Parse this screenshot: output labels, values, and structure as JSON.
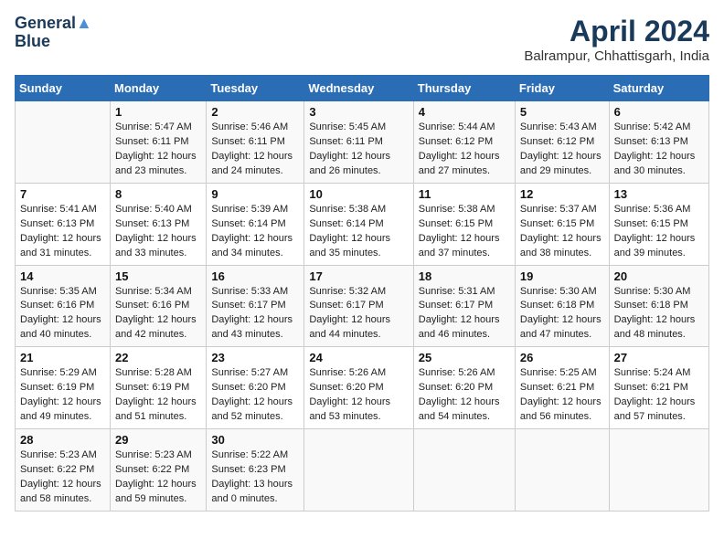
{
  "header": {
    "logo_line1": "General",
    "logo_line2": "Blue",
    "month": "April 2024",
    "location": "Balrampur, Chhattisgarh, India"
  },
  "columns": [
    "Sunday",
    "Monday",
    "Tuesday",
    "Wednesday",
    "Thursday",
    "Friday",
    "Saturday"
  ],
  "weeks": [
    [
      {
        "date": "",
        "sunrise": "",
        "sunset": "",
        "daylight": ""
      },
      {
        "date": "1",
        "sunrise": "Sunrise: 5:47 AM",
        "sunset": "Sunset: 6:11 PM",
        "daylight": "Daylight: 12 hours and 23 minutes."
      },
      {
        "date": "2",
        "sunrise": "Sunrise: 5:46 AM",
        "sunset": "Sunset: 6:11 PM",
        "daylight": "Daylight: 12 hours and 24 minutes."
      },
      {
        "date": "3",
        "sunrise": "Sunrise: 5:45 AM",
        "sunset": "Sunset: 6:11 PM",
        "daylight": "Daylight: 12 hours and 26 minutes."
      },
      {
        "date": "4",
        "sunrise": "Sunrise: 5:44 AM",
        "sunset": "Sunset: 6:12 PM",
        "daylight": "Daylight: 12 hours and 27 minutes."
      },
      {
        "date": "5",
        "sunrise": "Sunrise: 5:43 AM",
        "sunset": "Sunset: 6:12 PM",
        "daylight": "Daylight: 12 hours and 29 minutes."
      },
      {
        "date": "6",
        "sunrise": "Sunrise: 5:42 AM",
        "sunset": "Sunset: 6:13 PM",
        "daylight": "Daylight: 12 hours and 30 minutes."
      }
    ],
    [
      {
        "date": "7",
        "sunrise": "Sunrise: 5:41 AM",
        "sunset": "Sunset: 6:13 PM",
        "daylight": "Daylight: 12 hours and 31 minutes."
      },
      {
        "date": "8",
        "sunrise": "Sunrise: 5:40 AM",
        "sunset": "Sunset: 6:13 PM",
        "daylight": "Daylight: 12 hours and 33 minutes."
      },
      {
        "date": "9",
        "sunrise": "Sunrise: 5:39 AM",
        "sunset": "Sunset: 6:14 PM",
        "daylight": "Daylight: 12 hours and 34 minutes."
      },
      {
        "date": "10",
        "sunrise": "Sunrise: 5:38 AM",
        "sunset": "Sunset: 6:14 PM",
        "daylight": "Daylight: 12 hours and 35 minutes."
      },
      {
        "date": "11",
        "sunrise": "Sunrise: 5:38 AM",
        "sunset": "Sunset: 6:15 PM",
        "daylight": "Daylight: 12 hours and 37 minutes."
      },
      {
        "date": "12",
        "sunrise": "Sunrise: 5:37 AM",
        "sunset": "Sunset: 6:15 PM",
        "daylight": "Daylight: 12 hours and 38 minutes."
      },
      {
        "date": "13",
        "sunrise": "Sunrise: 5:36 AM",
        "sunset": "Sunset: 6:15 PM",
        "daylight": "Daylight: 12 hours and 39 minutes."
      }
    ],
    [
      {
        "date": "14",
        "sunrise": "Sunrise: 5:35 AM",
        "sunset": "Sunset: 6:16 PM",
        "daylight": "Daylight: 12 hours and 40 minutes."
      },
      {
        "date": "15",
        "sunrise": "Sunrise: 5:34 AM",
        "sunset": "Sunset: 6:16 PM",
        "daylight": "Daylight: 12 hours and 42 minutes."
      },
      {
        "date": "16",
        "sunrise": "Sunrise: 5:33 AM",
        "sunset": "Sunset: 6:17 PM",
        "daylight": "Daylight: 12 hours and 43 minutes."
      },
      {
        "date": "17",
        "sunrise": "Sunrise: 5:32 AM",
        "sunset": "Sunset: 6:17 PM",
        "daylight": "Daylight: 12 hours and 44 minutes."
      },
      {
        "date": "18",
        "sunrise": "Sunrise: 5:31 AM",
        "sunset": "Sunset: 6:17 PM",
        "daylight": "Daylight: 12 hours and 46 minutes."
      },
      {
        "date": "19",
        "sunrise": "Sunrise: 5:30 AM",
        "sunset": "Sunset: 6:18 PM",
        "daylight": "Daylight: 12 hours and 47 minutes."
      },
      {
        "date": "20",
        "sunrise": "Sunrise: 5:30 AM",
        "sunset": "Sunset: 6:18 PM",
        "daylight": "Daylight: 12 hours and 48 minutes."
      }
    ],
    [
      {
        "date": "21",
        "sunrise": "Sunrise: 5:29 AM",
        "sunset": "Sunset: 6:19 PM",
        "daylight": "Daylight: 12 hours and 49 minutes."
      },
      {
        "date": "22",
        "sunrise": "Sunrise: 5:28 AM",
        "sunset": "Sunset: 6:19 PM",
        "daylight": "Daylight: 12 hours and 51 minutes."
      },
      {
        "date": "23",
        "sunrise": "Sunrise: 5:27 AM",
        "sunset": "Sunset: 6:20 PM",
        "daylight": "Daylight: 12 hours and 52 minutes."
      },
      {
        "date": "24",
        "sunrise": "Sunrise: 5:26 AM",
        "sunset": "Sunset: 6:20 PM",
        "daylight": "Daylight: 12 hours and 53 minutes."
      },
      {
        "date": "25",
        "sunrise": "Sunrise: 5:26 AM",
        "sunset": "Sunset: 6:20 PM",
        "daylight": "Daylight: 12 hours and 54 minutes."
      },
      {
        "date": "26",
        "sunrise": "Sunrise: 5:25 AM",
        "sunset": "Sunset: 6:21 PM",
        "daylight": "Daylight: 12 hours and 56 minutes."
      },
      {
        "date": "27",
        "sunrise": "Sunrise: 5:24 AM",
        "sunset": "Sunset: 6:21 PM",
        "daylight": "Daylight: 12 hours and 57 minutes."
      }
    ],
    [
      {
        "date": "28",
        "sunrise": "Sunrise: 5:23 AM",
        "sunset": "Sunset: 6:22 PM",
        "daylight": "Daylight: 12 hours and 58 minutes."
      },
      {
        "date": "29",
        "sunrise": "Sunrise: 5:23 AM",
        "sunset": "Sunset: 6:22 PM",
        "daylight": "Daylight: 12 hours and 59 minutes."
      },
      {
        "date": "30",
        "sunrise": "Sunrise: 5:22 AM",
        "sunset": "Sunset: 6:23 PM",
        "daylight": "Daylight: 13 hours and 0 minutes."
      },
      {
        "date": "",
        "sunrise": "",
        "sunset": "",
        "daylight": ""
      },
      {
        "date": "",
        "sunrise": "",
        "sunset": "",
        "daylight": ""
      },
      {
        "date": "",
        "sunrise": "",
        "sunset": "",
        "daylight": ""
      },
      {
        "date": "",
        "sunrise": "",
        "sunset": "",
        "daylight": ""
      }
    ]
  ]
}
